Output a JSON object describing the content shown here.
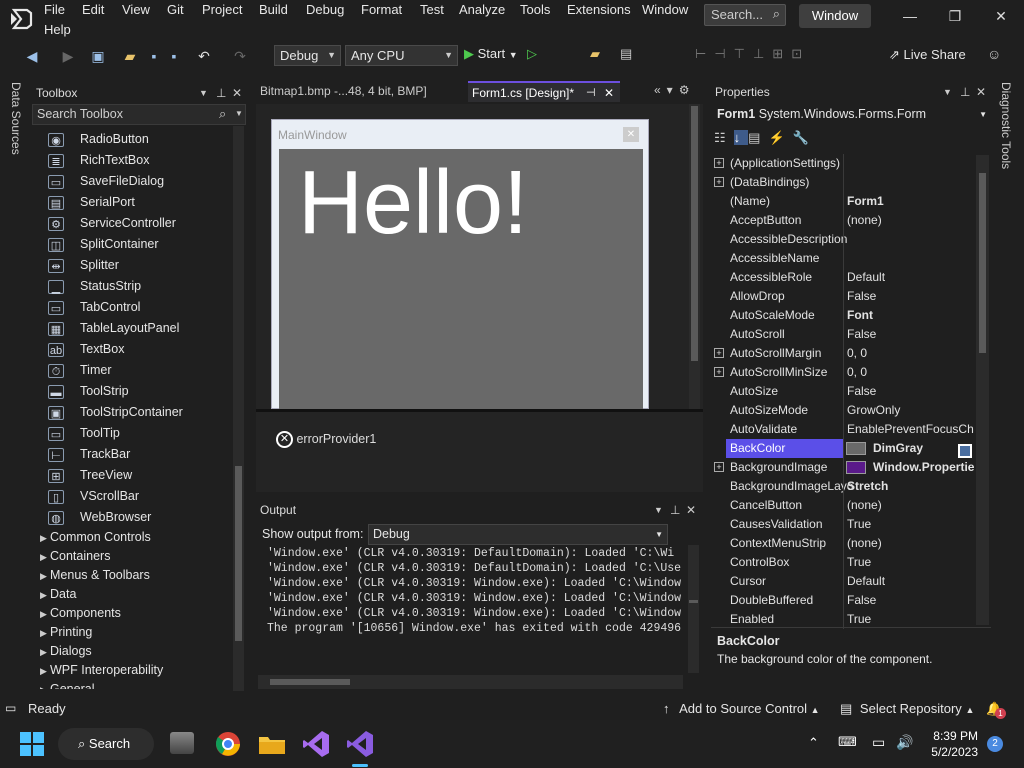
{
  "app": {
    "menus": [
      "File",
      "Edit",
      "View",
      "Git",
      "Project",
      "Build",
      "Debug",
      "Format",
      "Test",
      "Analyze",
      "Tools",
      "Extensions",
      "Window",
      "Help"
    ],
    "search_label": "Search...",
    "title": "Window",
    "minimize_glyph": "—",
    "maximize_glyph": "❐",
    "close_glyph": "✕"
  },
  "toolbar": {
    "config": "Debug",
    "platform": "Any CPU",
    "start_label": "Start",
    "live_share": "Live Share"
  },
  "side_tabs": {
    "left": "Data Sources",
    "right": "Diagnostic Tools"
  },
  "toolbox": {
    "title": "Toolbox",
    "search_placeholder": "Search Toolbox",
    "items": [
      {
        "label": "RadioButton",
        "glyph": "◉"
      },
      {
        "label": "RichTextBox",
        "glyph": "≣"
      },
      {
        "label": "SaveFileDialog",
        "glyph": "▭"
      },
      {
        "label": "SerialPort",
        "glyph": "▤"
      },
      {
        "label": "ServiceController",
        "glyph": "⚙"
      },
      {
        "label": "SplitContainer",
        "glyph": "◫"
      },
      {
        "label": "Splitter",
        "glyph": "⇹"
      },
      {
        "label": "StatusStrip",
        "glyph": "▁"
      },
      {
        "label": "TabControl",
        "glyph": "▭"
      },
      {
        "label": "TableLayoutPanel",
        "glyph": "▦"
      },
      {
        "label": "TextBox",
        "glyph": "ab"
      },
      {
        "label": "Timer",
        "glyph": "⏱"
      },
      {
        "label": "ToolStrip",
        "glyph": "▬"
      },
      {
        "label": "ToolStripContainer",
        "glyph": "▣"
      },
      {
        "label": "ToolTip",
        "glyph": "▭"
      },
      {
        "label": "TrackBar",
        "glyph": "⊢"
      },
      {
        "label": "TreeView",
        "glyph": "⊞"
      },
      {
        "label": "VScrollBar",
        "glyph": "▯"
      },
      {
        "label": "WebBrowser",
        "glyph": "◍"
      }
    ],
    "groups": [
      "Common Controls",
      "Containers",
      "Menus & Toolbars",
      "Data",
      "Components",
      "Printing",
      "Dialogs",
      "WPF Interoperability",
      "General"
    ]
  },
  "editor": {
    "tabs": [
      {
        "label": "Bitmap1.bmp -...48, 4 bit, BMP]"
      },
      {
        "label": "Form1.cs [Design]*"
      }
    ],
    "form_title": "MainWindow",
    "form_text": "Hello!",
    "component_tray_item": "errorProvider1"
  },
  "output": {
    "title": "Output",
    "show_from_label": "Show output from:",
    "source": "Debug",
    "lines": [
      "'Window.exe' (CLR v4.0.30319: DefaultDomain): Loaded 'C:\\Wi",
      "'Window.exe' (CLR v4.0.30319: DefaultDomain): Loaded 'C:\\Use",
      "'Window.exe' (CLR v4.0.30319: Window.exe): Loaded 'C:\\Window",
      "'Window.exe' (CLR v4.0.30319: Window.exe): Loaded 'C:\\Window",
      "'Window.exe' (CLR v4.0.30319: Window.exe): Loaded 'C:\\Window",
      "The program '[10656] Window.exe' has exited with code 429496"
    ]
  },
  "properties": {
    "title": "Properties",
    "object": "Form1",
    "object_type": "System.Windows.Forms.Form",
    "rows": [
      {
        "name": "(ApplicationSettings)",
        "value": "",
        "expand": true
      },
      {
        "name": "(DataBindings)",
        "value": "",
        "expand": true
      },
      {
        "name": "(Name)",
        "value": "Form1",
        "bold": true
      },
      {
        "name": "AcceptButton",
        "value": "(none)"
      },
      {
        "name": "AccessibleDescription",
        "value": ""
      },
      {
        "name": "AccessibleName",
        "value": ""
      },
      {
        "name": "AccessibleRole",
        "value": "Default"
      },
      {
        "name": "AllowDrop",
        "value": "False"
      },
      {
        "name": "AutoScaleMode",
        "value": "Font",
        "bold": true
      },
      {
        "name": "AutoScroll",
        "value": "False"
      },
      {
        "name": "AutoScrollMargin",
        "value": "0, 0",
        "expand": true
      },
      {
        "name": "AutoScrollMinSize",
        "value": "0, 0",
        "expand": true
      },
      {
        "name": "AutoSize",
        "value": "False"
      },
      {
        "name": "AutoSizeMode",
        "value": "GrowOnly"
      },
      {
        "name": "AutoValidate",
        "value": "EnablePreventFocusChange"
      },
      {
        "name": "BackColor",
        "value": "DimGray",
        "bold": true,
        "selected": true,
        "swatch": "#696969"
      },
      {
        "name": "BackgroundImage",
        "value": "Window.Properties.Resources.bg",
        "bold": true,
        "expand": true,
        "swatch": "#5a1a8a"
      },
      {
        "name": "BackgroundImageLayout",
        "value": "Stretch",
        "bold": true
      },
      {
        "name": "CancelButton",
        "value": "(none)"
      },
      {
        "name": "CausesValidation",
        "value": "True"
      },
      {
        "name": "ContextMenuStrip",
        "value": "(none)"
      },
      {
        "name": "ControlBox",
        "value": "True"
      },
      {
        "name": "Cursor",
        "value": "Default"
      },
      {
        "name": "DoubleBuffered",
        "value": "False"
      },
      {
        "name": "Enabled",
        "value": "True"
      }
    ],
    "desc_title": "BackColor",
    "desc_text": "The background color of the component."
  },
  "status": {
    "ready": "Ready",
    "source_control": "Add to Source Control",
    "repo": "Select Repository",
    "notifications": "1"
  },
  "taskbar": {
    "search": "Search",
    "time": "8:39 PM",
    "date": "5/2/2023",
    "badge": "2"
  },
  "colors": {
    "accent": "#6c4fe0",
    "selection": "#5b4fe8",
    "form_bg": "#696969"
  }
}
